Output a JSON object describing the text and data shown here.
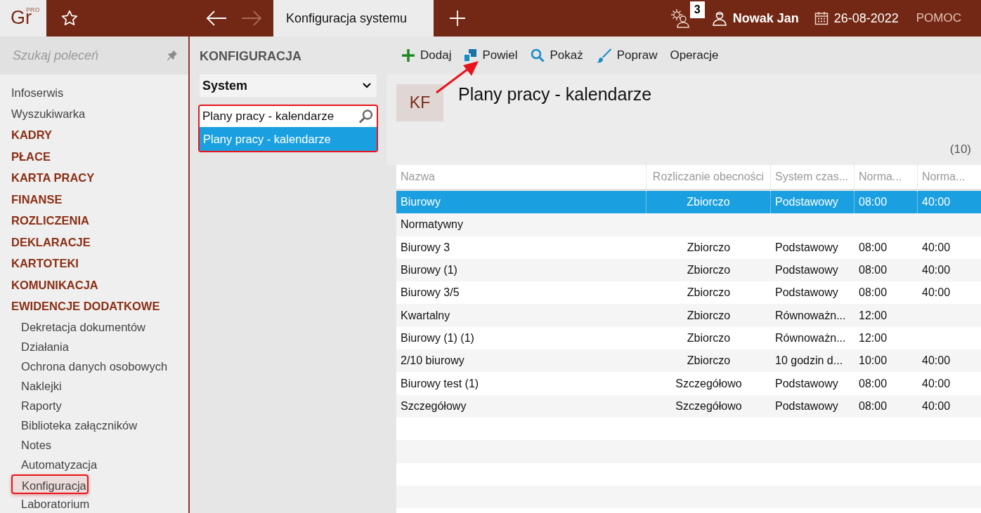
{
  "app": {
    "logo": "Gr",
    "logo_badge": "PRO"
  },
  "tabs": [
    {
      "label": "Konfiguracja systemu",
      "selected": true
    }
  ],
  "header": {
    "notifications": "3",
    "user": "Nowak Jan",
    "date": "26-08-2022",
    "help": "POMOC"
  },
  "sidebar": {
    "search_placeholder": "Szukaj poleceń",
    "items": [
      {
        "label": "Infoserwis",
        "kind": "link",
        "highlighted": false
      },
      {
        "label": "Wyszukiwarka",
        "kind": "link",
        "highlighted": false
      },
      {
        "label": "KADRY",
        "kind": "section",
        "highlighted": false
      },
      {
        "label": "PŁACE",
        "kind": "section",
        "highlighted": false
      },
      {
        "label": "KARTA PRACY",
        "kind": "section",
        "highlighted": false
      },
      {
        "label": "FINANSE",
        "kind": "section",
        "highlighted": false
      },
      {
        "label": "ROZLICZENIA",
        "kind": "section",
        "highlighted": false
      },
      {
        "label": "DEKLARACJE",
        "kind": "section",
        "highlighted": false
      },
      {
        "label": "KARTOTEKI",
        "kind": "section",
        "highlighted": false
      },
      {
        "label": "KOMUNIKACJA",
        "kind": "section",
        "highlighted": false
      },
      {
        "label": "EWIDENCJE DODATKOWE",
        "kind": "section",
        "highlighted": false
      },
      {
        "label": "Dekretacja dokumentów",
        "kind": "sub",
        "highlighted": false
      },
      {
        "label": "Działania",
        "kind": "sub",
        "highlighted": false
      },
      {
        "label": "Ochrona danych osobowych",
        "kind": "sub",
        "highlighted": false
      },
      {
        "label": "Naklejki",
        "kind": "sub",
        "highlighted": false
      },
      {
        "label": "Raporty",
        "kind": "sub",
        "highlighted": false
      },
      {
        "label": "Biblioteka załączników",
        "kind": "sub",
        "highlighted": false
      },
      {
        "label": "Notes",
        "kind": "sub",
        "highlighted": false
      },
      {
        "label": "Automatyzacja",
        "kind": "sub",
        "highlighted": false
      },
      {
        "label": "Konfiguracja",
        "kind": "sub",
        "highlighted": true
      },
      {
        "label": "Laboratorium",
        "kind": "sub",
        "highlighted": false
      }
    ]
  },
  "config_panel": {
    "title": "KONFIGURACJA",
    "dropdown": "System",
    "search_value": "Plany pracy - kalendarze",
    "results": [
      {
        "label": "Plany pracy - kalendarze",
        "selected": true
      }
    ]
  },
  "toolbar": [
    {
      "label": "Dodaj",
      "kind": "add"
    },
    {
      "label": "Powiel",
      "kind": "duplicate"
    },
    {
      "label": "Pokaż",
      "kind": "show"
    },
    {
      "label": "Popraw",
      "kind": "edit"
    },
    {
      "label": "Operacje",
      "kind": "menu"
    }
  ],
  "content": {
    "badge": "KF",
    "title": "Plany pracy - kalendarze",
    "count": "(10)"
  },
  "table": {
    "columns": [
      "Nazwa",
      "Rozliczanie obecności",
      "System czas...",
      "Norma...",
      "Norma..."
    ],
    "rows": [
      {
        "cells": [
          "Biurowy",
          "Zbiorczo",
          "Podstawowy",
          "08:00",
          "40:00"
        ],
        "selected": true
      },
      {
        "cells": [
          "Normatywny",
          "",
          "",
          "",
          ""
        ],
        "selected": false
      },
      {
        "cells": [
          "Biurowy 3",
          "Zbiorczo",
          "Podstawowy",
          "08:00",
          "40:00"
        ],
        "selected": false
      },
      {
        "cells": [
          "Biurowy (1)",
          "Zbiorczo",
          "Podstawowy",
          "08:00",
          "40:00"
        ],
        "selected": false
      },
      {
        "cells": [
          "Biurowy 3/5",
          "Zbiorczo",
          "Podstawowy",
          "08:00",
          "40:00"
        ],
        "selected": false
      },
      {
        "cells": [
          "Kwartalny",
          "Zbiorczo",
          "Równoważn...",
          "12:00",
          ""
        ],
        "selected": false
      },
      {
        "cells": [
          "Biurowy (1) (1)",
          "Zbiorczo",
          "Równoważn...",
          "12:00",
          ""
        ],
        "selected": false
      },
      {
        "cells": [
          "2/10 biurowy",
          "Zbiorczo",
          "10 godzin d...",
          "10:00",
          "40:00"
        ],
        "selected": false
      },
      {
        "cells": [
          "Biurowy test (1)",
          "Szczegółowo",
          "Podstawowy",
          "08:00",
          "40:00"
        ],
        "selected": false
      },
      {
        "cells": [
          "Szczegółowy",
          "Szczegółowo",
          "Podstawowy",
          "08:00",
          "40:00"
        ],
        "selected": false
      }
    ]
  }
}
